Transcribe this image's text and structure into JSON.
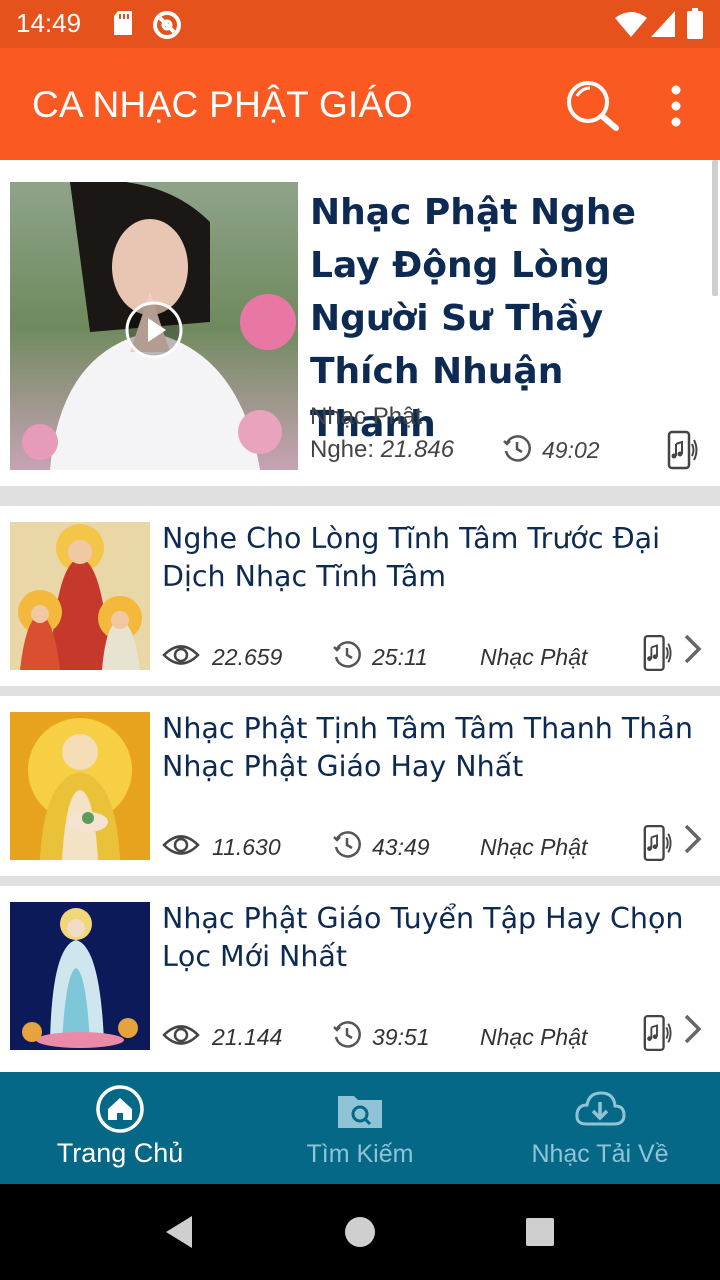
{
  "status_bar": {
    "time": "14:49",
    "icons": [
      "sd-card-icon",
      "do-not-disturb-icon",
      "wifi-icon",
      "cellular-signal-icon",
      "battery-icon"
    ]
  },
  "app_bar": {
    "title": "CA NHẠC PHẬT GIÁO",
    "actions": [
      "search-icon",
      "more-vert-icon"
    ]
  },
  "featured": {
    "title": "Nhạc Phật Nghe Lay Động Lòng Người Sư Thầy Thích Nhuận Thanh",
    "category": "Nhạc Phật",
    "views_label": "Nghe: ",
    "views": "21.846",
    "duration": "49:02",
    "icons": [
      "play-icon",
      "clock-icon",
      "phone-audio-icon"
    ]
  },
  "items": [
    {
      "title": "Nghe Cho Lòng Tĩnh Tâm Trước Đại Dịch Nhạc Tĩnh Tâm",
      "views": "22.659",
      "duration": "25:11",
      "category": "Nhạc Phật"
    },
    {
      "title": "Nhạc Phật Tịnh Tâm Tâm Thanh Thản Nhạc Phật Giáo Hay Nhất",
      "views": "11.630",
      "duration": "43:49",
      "category": "Nhạc Phật"
    },
    {
      "title": "Nhạc Phật Giáo Tuyển Tập Hay Chọn Lọc Mới Nhất",
      "views": "21.144",
      "duration": "39:51",
      "category": "Nhạc Phật"
    }
  ],
  "bottom_nav": [
    {
      "label": "Trang Chủ",
      "icon": "home-icon",
      "active": true
    },
    {
      "label": "Tìm Kiếm",
      "icon": "folder-search-icon",
      "active": false
    },
    {
      "label": "Nhạc Tải Về",
      "icon": "cloud-download-icon",
      "active": false
    }
  ],
  "colors": {
    "status_bar": "#e6521c",
    "app_bar": "#fa5a22",
    "title_text": "#0d2a52",
    "bottom_nav": "#066887"
  }
}
